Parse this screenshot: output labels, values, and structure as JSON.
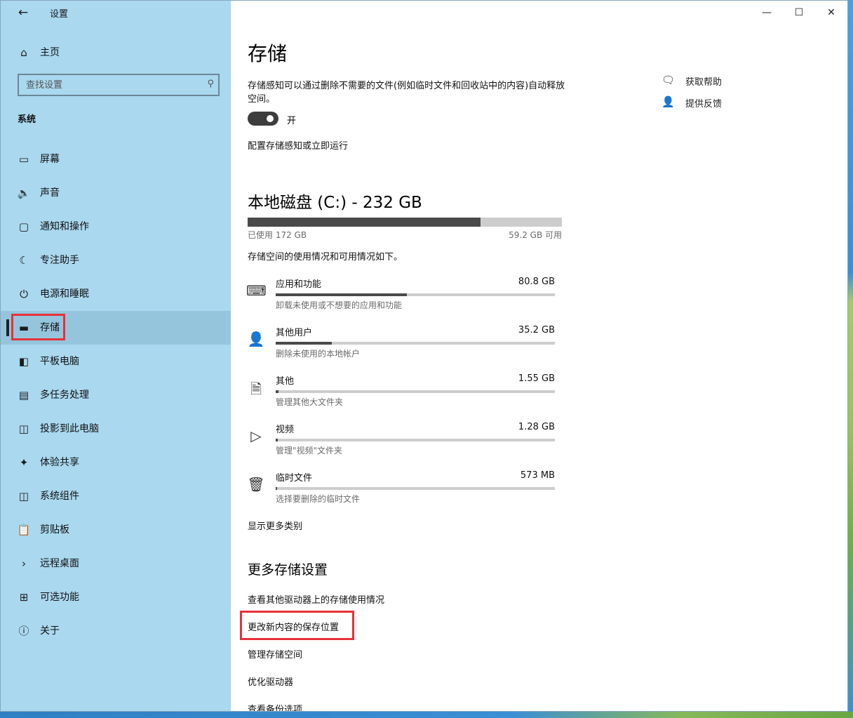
{
  "window": {
    "title": "设置"
  },
  "sidebar": {
    "home_label": "主页",
    "search_placeholder": "查找设置",
    "section": "系统",
    "items": [
      {
        "label": "屏幕",
        "icon": "monitor-icon"
      },
      {
        "label": "声音",
        "icon": "speaker-icon"
      },
      {
        "label": "通知和操作",
        "icon": "notification-icon"
      },
      {
        "label": "专注助手",
        "icon": "moon-icon"
      },
      {
        "label": "电源和睡眠",
        "icon": "power-icon"
      },
      {
        "label": "存储",
        "icon": "storage-icon",
        "active": true
      },
      {
        "label": "平板电脑",
        "icon": "tablet-icon"
      },
      {
        "label": "多任务处理",
        "icon": "multitask-icon"
      },
      {
        "label": "投影到此电脑",
        "icon": "projector-icon"
      },
      {
        "label": "体验共享",
        "icon": "share-icon"
      },
      {
        "label": "系统组件",
        "icon": "components-icon"
      },
      {
        "label": "剪贴板",
        "icon": "clipboard-icon"
      },
      {
        "label": "远程桌面",
        "icon": "remote-icon"
      },
      {
        "label": "可选功能",
        "icon": "features-icon"
      },
      {
        "label": "关于",
        "icon": "info-icon"
      }
    ]
  },
  "main": {
    "title": "存储",
    "sense_desc": "存储感知可以通过删除不需要的文件(例如临时文件和回收站中的内容)自动释放空间。",
    "toggle_label": "开",
    "toggle_on": true,
    "config_link": "配置存储感知或立即运行",
    "disk": {
      "title": "本地磁盘 (C:) - 232 GB",
      "used_label": "已使用 172 GB",
      "free_label": "59.2 GB 可用",
      "used_fraction": 0.74
    },
    "usage_desc": "存储空间的使用情况和可用情况如下。",
    "categories": [
      {
        "name": "应用和功能",
        "size": "80.8 GB",
        "sub": "卸载未使用或不想要的应用和功能",
        "fraction": 0.47,
        "icon": "keyboard-icon"
      },
      {
        "name": "其他用户",
        "size": "35.2 GB",
        "sub": "删除未使用的本地帐户",
        "fraction": 0.2,
        "icon": "user-icon"
      },
      {
        "name": "其他",
        "size": "1.55 GB",
        "sub": "管理其他大文件夹",
        "fraction": 0.01,
        "icon": "file-icon"
      },
      {
        "name": "视频",
        "size": "1.28 GB",
        "sub": "管理\"视频\"文件夹",
        "fraction": 0.008,
        "icon": "video-icon"
      },
      {
        "name": "临时文件",
        "size": "573 MB",
        "sub": "选择要删除的临时文件",
        "fraction": 0.004,
        "icon": "trash-icon"
      }
    ],
    "show_more": "显示更多类别",
    "more_title": "更多存储设置",
    "more_links": [
      "查看其他驱动器上的存储使用情况",
      "更改新内容的保存位置",
      "管理存储空间",
      "优化驱动器",
      "查看备份选项"
    ]
  },
  "help": {
    "get_help": "获取帮助",
    "feedback": "提供反馈"
  }
}
